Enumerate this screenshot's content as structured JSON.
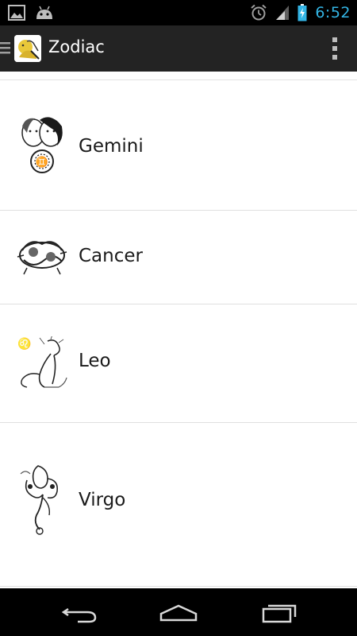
{
  "status_bar": {
    "time": "6:52",
    "left_icons": [
      "gallery-icon",
      "android-icon"
    ],
    "right_icons": [
      "alarm-icon",
      "signal-icon",
      "battery-charging-icon"
    ]
  },
  "action_bar": {
    "title": "Zodiac",
    "drawer_icon": "menu-drawer-icon",
    "overflow_icon": "overflow-menu-icon"
  },
  "list": {
    "items": [
      {
        "label": "Gemini",
        "icon": "gemini-illustration"
      },
      {
        "label": "Cancer",
        "icon": "cancer-illustration"
      },
      {
        "label": "Leo",
        "icon": "leo-illustration"
      },
      {
        "label": "Virgo",
        "icon": "virgo-illustration"
      }
    ]
  },
  "nav_bar": {
    "buttons": [
      "back-icon",
      "home-icon",
      "recent-apps-icon"
    ]
  },
  "colors": {
    "status_bar_bg": "#000000",
    "action_bar_bg": "#232323",
    "clock": "#33b5e5",
    "list_bg": "#ffffff",
    "divider": "#e0e0e0"
  }
}
